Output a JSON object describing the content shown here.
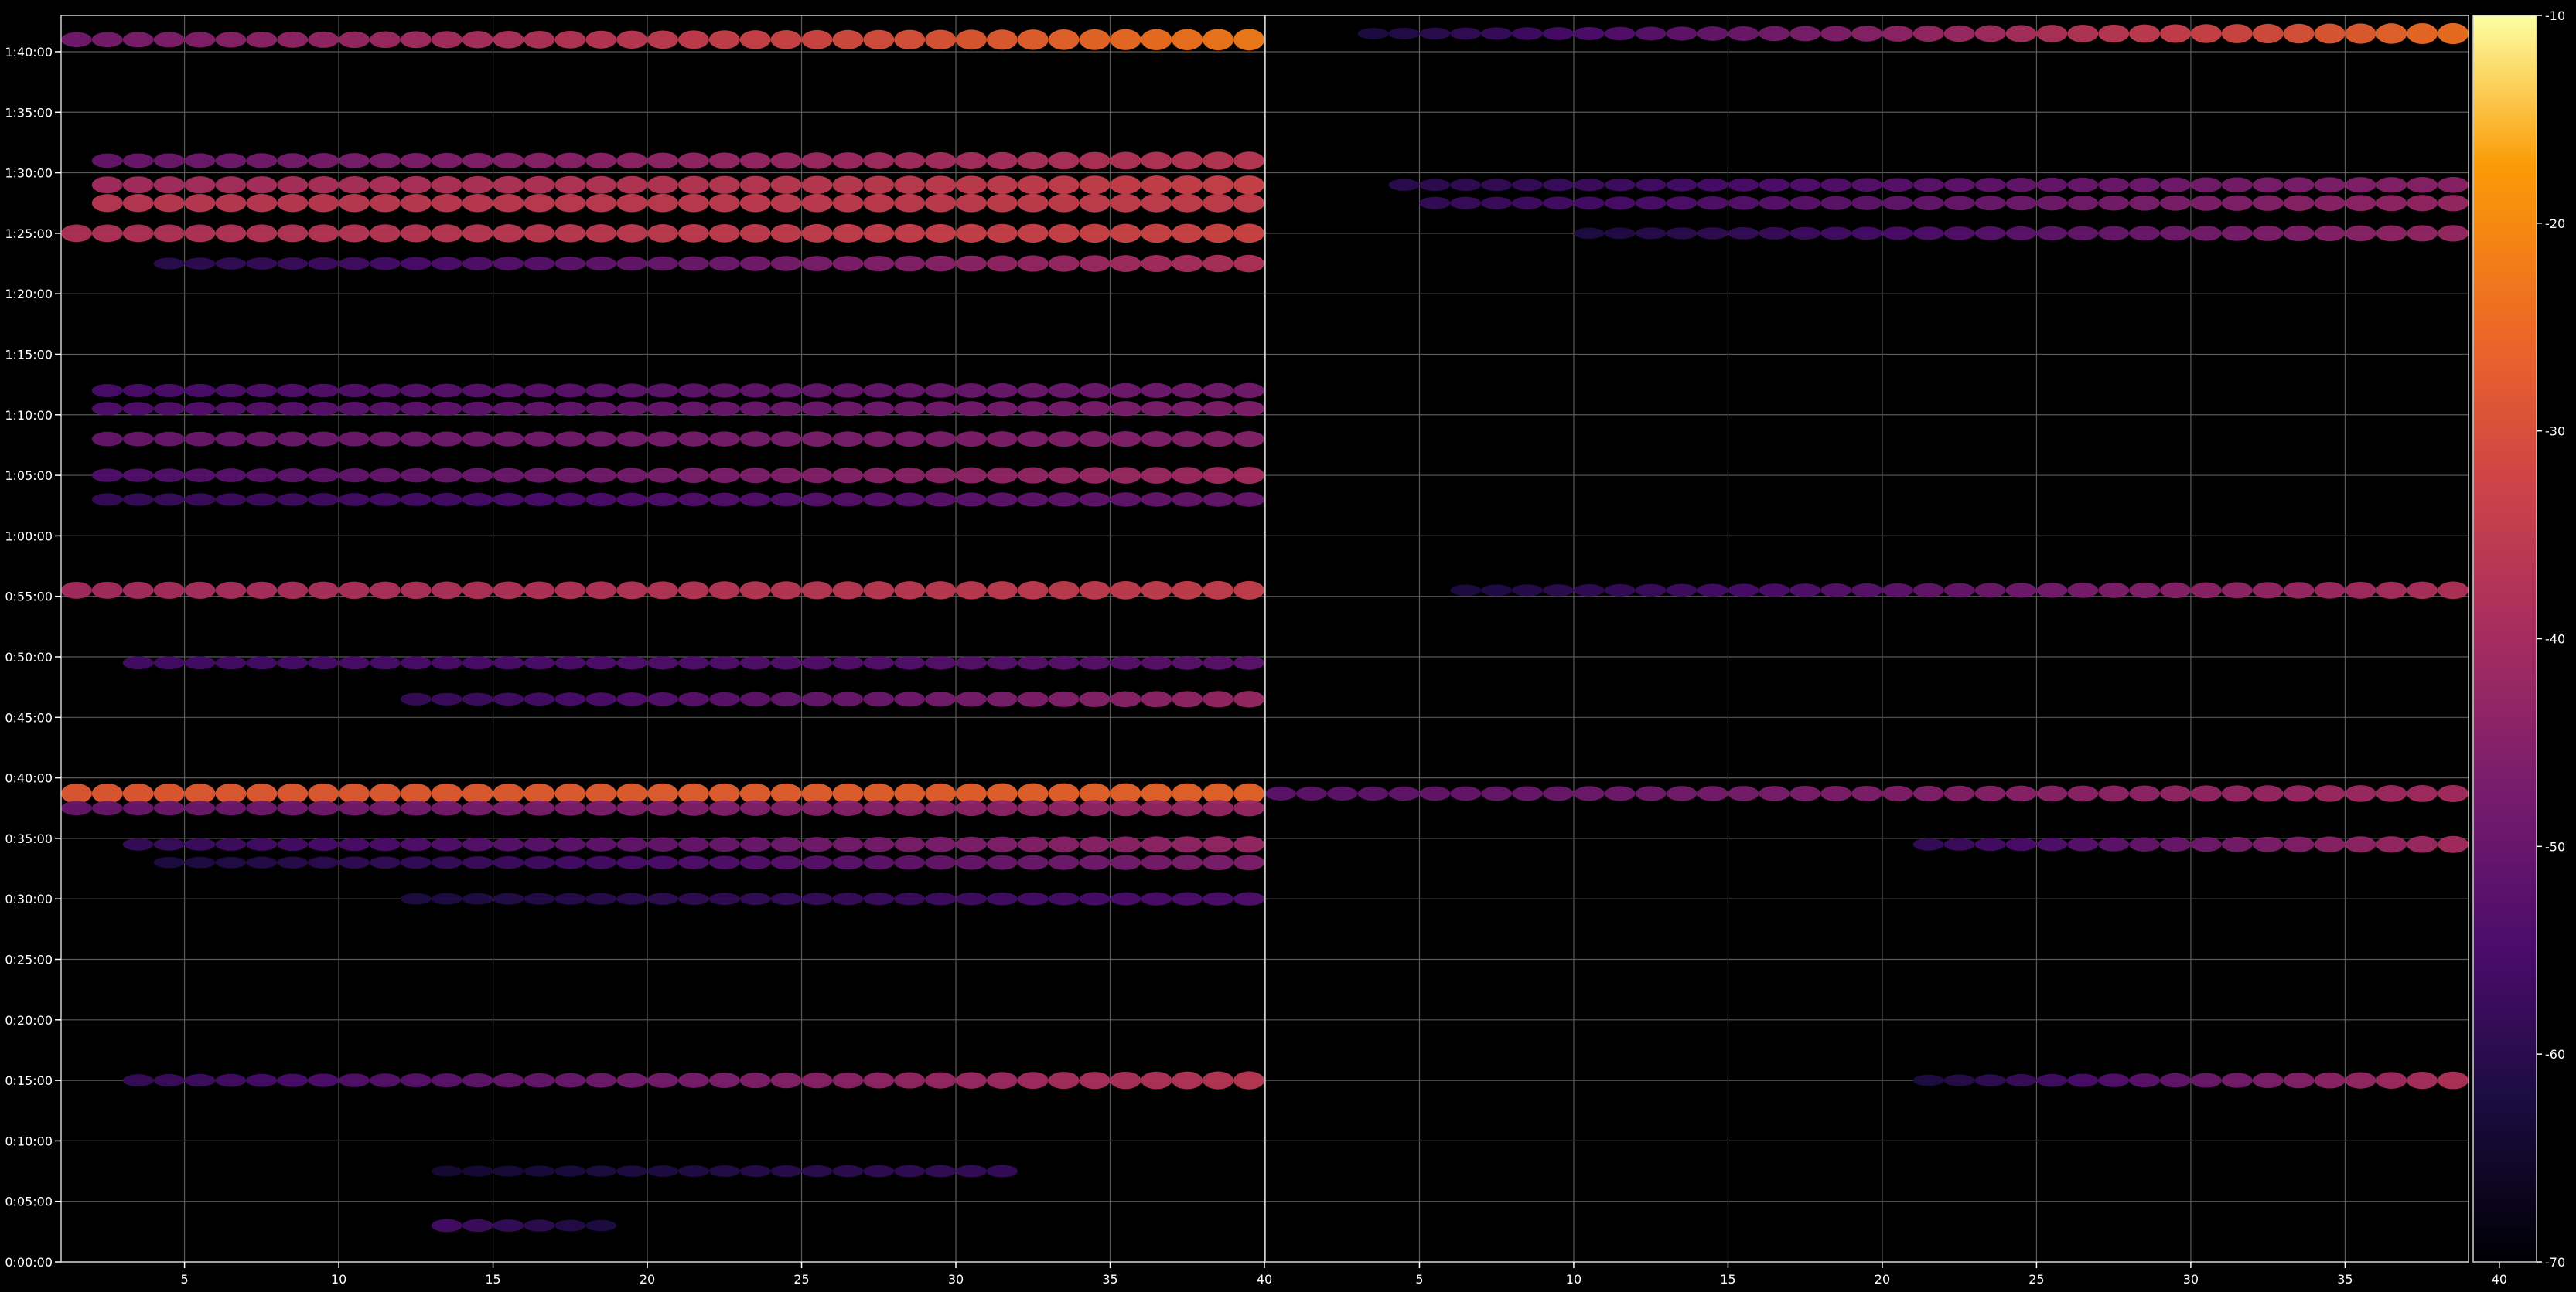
{
  "chart_data": {
    "type": "heatmap",
    "title": "",
    "xlabel": "",
    "ylabel": "",
    "grid": true,
    "background": "#000000",
    "grid_color": "#5a5a5a",
    "tick_color": "#ffffff",
    "colormap": "inferno",
    "y": {
      "ticks": [
        "0:00:00",
        "0:05:00",
        "0:10:00",
        "0:15:00",
        "0:20:00",
        "0:25:00",
        "0:30:00",
        "0:35:00",
        "0:40:00",
        "0:45:00",
        "0:50:00",
        "0:55:00",
        "1:00:00",
        "1:05:00",
        "1:10:00",
        "1:15:00",
        "1:20:00",
        "1:25:00",
        "1:30:00",
        "1:35:00",
        "1:40:00"
      ],
      "range_minutes": [
        0,
        103
      ]
    },
    "panels": [
      {
        "xlim": [
          1,
          40
        ],
        "ticks": [
          "5",
          "10",
          "15",
          "20",
          "25",
          "30",
          "35",
          "40"
        ],
        "tick_values": [
          5,
          10,
          15,
          20,
          25,
          30,
          35,
          40
        ]
      },
      {
        "xlim": [
          40,
          79
        ],
        "ticks": [
          "5",
          "10",
          "15",
          "20",
          "25",
          "30",
          "35",
          "40"
        ],
        "tick_values": [
          45,
          50,
          55,
          60,
          65,
          70,
          75,
          80
        ]
      }
    ],
    "colorbar": {
      "range": [
        -70,
        -10
      ],
      "ticks": [
        "-10",
        "-20",
        "-30",
        "-40",
        "-50",
        "-60",
        "-70"
      ],
      "tick_values": [
        -10,
        -20,
        -30,
        -40,
        -50,
        -60,
        -70
      ]
    },
    "series": [
      {
        "minute": 101.0,
        "panel": 0,
        "x_from": 1,
        "x_to": 39,
        "start": -48,
        "end": -22
      },
      {
        "minute": 101.5,
        "panel": 1,
        "x_from": 43,
        "x_to": 78,
        "start": -62,
        "end": -24
      },
      {
        "minute": 91.0,
        "panel": 0,
        "x_from": 2,
        "x_to": 39,
        "start": -50,
        "end": -36
      },
      {
        "minute": 89.0,
        "panel": 0,
        "x_from": 2,
        "x_to": 39,
        "start": -40,
        "end": -33
      },
      {
        "minute": 89.0,
        "panel": 1,
        "x_from": 44,
        "x_to": 78,
        "start": -60,
        "end": -44
      },
      {
        "minute": 87.5,
        "panel": 0,
        "x_from": 2,
        "x_to": 39,
        "start": -36,
        "end": -34
      },
      {
        "minute": 87.5,
        "panel": 1,
        "x_from": 45,
        "x_to": 78,
        "start": -58,
        "end": -42
      },
      {
        "minute": 85.0,
        "panel": 0,
        "x_from": 1,
        "x_to": 39,
        "start": -38,
        "end": -32
      },
      {
        "minute": 85.0,
        "panel": 1,
        "x_from": 50,
        "x_to": 78,
        "start": -62,
        "end": -42
      },
      {
        "minute": 82.5,
        "panel": 0,
        "x_from": 4,
        "x_to": 39,
        "start": -60,
        "end": -38
      },
      {
        "minute": 72.0,
        "panel": 0,
        "x_from": 2,
        "x_to": 39,
        "start": -55,
        "end": -48
      },
      {
        "minute": 70.5,
        "panel": 0,
        "x_from": 2,
        "x_to": 39,
        "start": -54,
        "end": -46
      },
      {
        "minute": 68.0,
        "panel": 0,
        "x_from": 2,
        "x_to": 39,
        "start": -50,
        "end": -45
      },
      {
        "minute": 65.0,
        "panel": 0,
        "x_from": 2,
        "x_to": 39,
        "start": -54,
        "end": -40
      },
      {
        "minute": 63.0,
        "panel": 0,
        "x_from": 2,
        "x_to": 39,
        "start": -58,
        "end": -50
      },
      {
        "minute": 55.5,
        "panel": 0,
        "x_from": 1,
        "x_to": 39,
        "start": -40,
        "end": -34
      },
      {
        "minute": 55.5,
        "panel": 1,
        "x_from": 46,
        "x_to": 78,
        "start": -62,
        "end": -38
      },
      {
        "minute": 49.5,
        "panel": 0,
        "x_from": 3,
        "x_to": 39,
        "start": -56,
        "end": -52
      },
      {
        "minute": 46.5,
        "panel": 0,
        "x_from": 12,
        "x_to": 39,
        "start": -58,
        "end": -42
      },
      {
        "minute": 38.7,
        "panel": 0,
        "x_from": 1,
        "x_to": 39,
        "start": -28,
        "end": -26
      },
      {
        "minute": 38.7,
        "panel": 1,
        "x_from": 40,
        "x_to": 78,
        "start": -52,
        "end": -40
      },
      {
        "minute": 37.5,
        "panel": 0,
        "x_from": 1,
        "x_to": 39,
        "start": -50,
        "end": -42
      },
      {
        "minute": 34.5,
        "panel": 0,
        "x_from": 3,
        "x_to": 39,
        "start": -58,
        "end": -42
      },
      {
        "minute": 34.5,
        "panel": 1,
        "x_from": 61,
        "x_to": 78,
        "start": -58,
        "end": -40
      },
      {
        "minute": 33.0,
        "panel": 0,
        "x_from": 4,
        "x_to": 39,
        "start": -62,
        "end": -46
      },
      {
        "minute": 30.0,
        "panel": 0,
        "x_from": 12,
        "x_to": 39,
        "start": -62,
        "end": -54
      },
      {
        "minute": 15.0,
        "panel": 0,
        "x_from": 3,
        "x_to": 39,
        "start": -58,
        "end": -36
      },
      {
        "minute": 15.0,
        "panel": 1,
        "x_from": 61,
        "x_to": 78,
        "start": -62,
        "end": -38
      },
      {
        "minute": 7.5,
        "panel": 0,
        "x_from": 13,
        "x_to": 31,
        "start": -64,
        "end": -58
      },
      {
        "minute": 3.0,
        "panel": 0,
        "x_from": 13,
        "x_to": 18,
        "start": -56,
        "end": -62
      }
    ]
  }
}
